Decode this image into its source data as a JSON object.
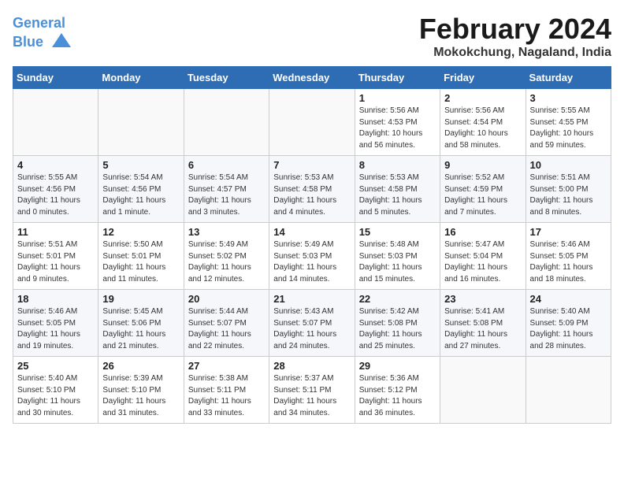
{
  "header": {
    "logo_line1": "General",
    "logo_line2": "Blue",
    "title": "February 2024",
    "subtitle": "Mokokchung, Nagaland, India"
  },
  "weekdays": [
    "Sunday",
    "Monday",
    "Tuesday",
    "Wednesday",
    "Thursday",
    "Friday",
    "Saturday"
  ],
  "rows": [
    [
      {
        "day": "",
        "info": ""
      },
      {
        "day": "",
        "info": ""
      },
      {
        "day": "",
        "info": ""
      },
      {
        "day": "",
        "info": ""
      },
      {
        "day": "1",
        "info": "Sunrise: 5:56 AM\nSunset: 4:53 PM\nDaylight: 10 hours and 56 minutes."
      },
      {
        "day": "2",
        "info": "Sunrise: 5:56 AM\nSunset: 4:54 PM\nDaylight: 10 hours and 58 minutes."
      },
      {
        "day": "3",
        "info": "Sunrise: 5:55 AM\nSunset: 4:55 PM\nDaylight: 10 hours and 59 minutes."
      }
    ],
    [
      {
        "day": "4",
        "info": "Sunrise: 5:55 AM\nSunset: 4:56 PM\nDaylight: 11 hours and 0 minutes."
      },
      {
        "day": "5",
        "info": "Sunrise: 5:54 AM\nSunset: 4:56 PM\nDaylight: 11 hours and 1 minute."
      },
      {
        "day": "6",
        "info": "Sunrise: 5:54 AM\nSunset: 4:57 PM\nDaylight: 11 hours and 3 minutes."
      },
      {
        "day": "7",
        "info": "Sunrise: 5:53 AM\nSunset: 4:58 PM\nDaylight: 11 hours and 4 minutes."
      },
      {
        "day": "8",
        "info": "Sunrise: 5:53 AM\nSunset: 4:58 PM\nDaylight: 11 hours and 5 minutes."
      },
      {
        "day": "9",
        "info": "Sunrise: 5:52 AM\nSunset: 4:59 PM\nDaylight: 11 hours and 7 minutes."
      },
      {
        "day": "10",
        "info": "Sunrise: 5:51 AM\nSunset: 5:00 PM\nDaylight: 11 hours and 8 minutes."
      }
    ],
    [
      {
        "day": "11",
        "info": "Sunrise: 5:51 AM\nSunset: 5:01 PM\nDaylight: 11 hours and 9 minutes."
      },
      {
        "day": "12",
        "info": "Sunrise: 5:50 AM\nSunset: 5:01 PM\nDaylight: 11 hours and 11 minutes."
      },
      {
        "day": "13",
        "info": "Sunrise: 5:49 AM\nSunset: 5:02 PM\nDaylight: 11 hours and 12 minutes."
      },
      {
        "day": "14",
        "info": "Sunrise: 5:49 AM\nSunset: 5:03 PM\nDaylight: 11 hours and 14 minutes."
      },
      {
        "day": "15",
        "info": "Sunrise: 5:48 AM\nSunset: 5:03 PM\nDaylight: 11 hours and 15 minutes."
      },
      {
        "day": "16",
        "info": "Sunrise: 5:47 AM\nSunset: 5:04 PM\nDaylight: 11 hours and 16 minutes."
      },
      {
        "day": "17",
        "info": "Sunrise: 5:46 AM\nSunset: 5:05 PM\nDaylight: 11 hours and 18 minutes."
      }
    ],
    [
      {
        "day": "18",
        "info": "Sunrise: 5:46 AM\nSunset: 5:05 PM\nDaylight: 11 hours and 19 minutes."
      },
      {
        "day": "19",
        "info": "Sunrise: 5:45 AM\nSunset: 5:06 PM\nDaylight: 11 hours and 21 minutes."
      },
      {
        "day": "20",
        "info": "Sunrise: 5:44 AM\nSunset: 5:07 PM\nDaylight: 11 hours and 22 minutes."
      },
      {
        "day": "21",
        "info": "Sunrise: 5:43 AM\nSunset: 5:07 PM\nDaylight: 11 hours and 24 minutes."
      },
      {
        "day": "22",
        "info": "Sunrise: 5:42 AM\nSunset: 5:08 PM\nDaylight: 11 hours and 25 minutes."
      },
      {
        "day": "23",
        "info": "Sunrise: 5:41 AM\nSunset: 5:08 PM\nDaylight: 11 hours and 27 minutes."
      },
      {
        "day": "24",
        "info": "Sunrise: 5:40 AM\nSunset: 5:09 PM\nDaylight: 11 hours and 28 minutes."
      }
    ],
    [
      {
        "day": "25",
        "info": "Sunrise: 5:40 AM\nSunset: 5:10 PM\nDaylight: 11 hours and 30 minutes."
      },
      {
        "day": "26",
        "info": "Sunrise: 5:39 AM\nSunset: 5:10 PM\nDaylight: 11 hours and 31 minutes."
      },
      {
        "day": "27",
        "info": "Sunrise: 5:38 AM\nSunset: 5:11 PM\nDaylight: 11 hours and 33 minutes."
      },
      {
        "day": "28",
        "info": "Sunrise: 5:37 AM\nSunset: 5:11 PM\nDaylight: 11 hours and 34 minutes."
      },
      {
        "day": "29",
        "info": "Sunrise: 5:36 AM\nSunset: 5:12 PM\nDaylight: 11 hours and 36 minutes."
      },
      {
        "day": "",
        "info": ""
      },
      {
        "day": "",
        "info": ""
      }
    ]
  ]
}
